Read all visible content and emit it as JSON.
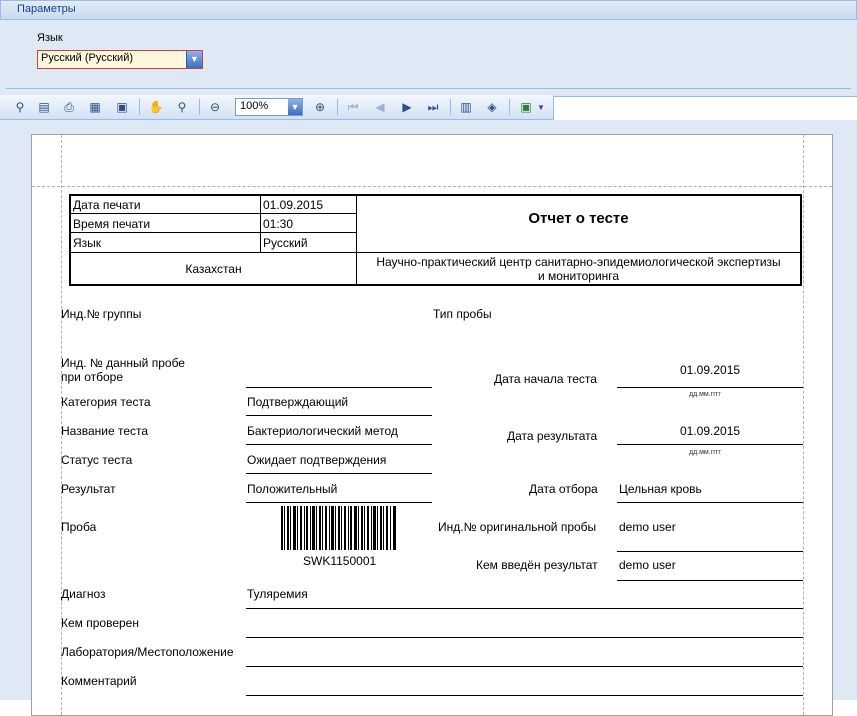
{
  "params": {
    "title": "Параметры",
    "language_label": "Язык",
    "language_value": "Русский (Русский)"
  },
  "toolbar": {
    "zoom_value": "100%"
  },
  "report": {
    "print_date_label": "Дата печати",
    "print_date": "01.09.2015",
    "print_time_label": "Время печати",
    "print_time": "01:30",
    "language_label": "Язык",
    "language": "Русский",
    "title": "Отчет о тесте",
    "country": "Казахстан",
    "organization_line1": "Научно-практический центр санитарно-эпидемиологической экспертизы",
    "organization_line2": "и мониторинга",
    "group_id_label": "Инд.№ группы",
    "sample_type_label": "Тип пробы",
    "sample_id_label_line1": "Инд. № данный пробе",
    "sample_id_label_line2": "при отборе",
    "test_start_label": "Дата начала теста",
    "test_start": "01.09.2015",
    "date_hint": "дд.мм.гггг",
    "test_category_label": "Категория теста",
    "test_category": "Подтверждающий",
    "test_name_label": "Название теста",
    "test_name": "Бактериологический метод",
    "result_date_label": "Дата результата",
    "result_date": "01.09.2015",
    "test_status_label": "Статус теста",
    "test_status": "Ожидает подтверждения",
    "result_label": "Результат",
    "result": "Положительный",
    "collection_date_label": "Дата отбора",
    "collection_value": "Цельная кровь",
    "sample_label": "Проба",
    "barcode_text": "SWK1150001",
    "original_sample_id_label": "Инд.№ оригинальной пробы",
    "original_sample_id": "demo  user",
    "entered_by_label": "Кем введён результат",
    "entered_by": "demo  user",
    "diagnosis_label": "Диагноз",
    "diagnosis": "Туляремия",
    "checked_by_label": "Кем проверен",
    "lab_location_label": "Лаборатория/Местоположение",
    "comment_label": "Комментарий"
  }
}
